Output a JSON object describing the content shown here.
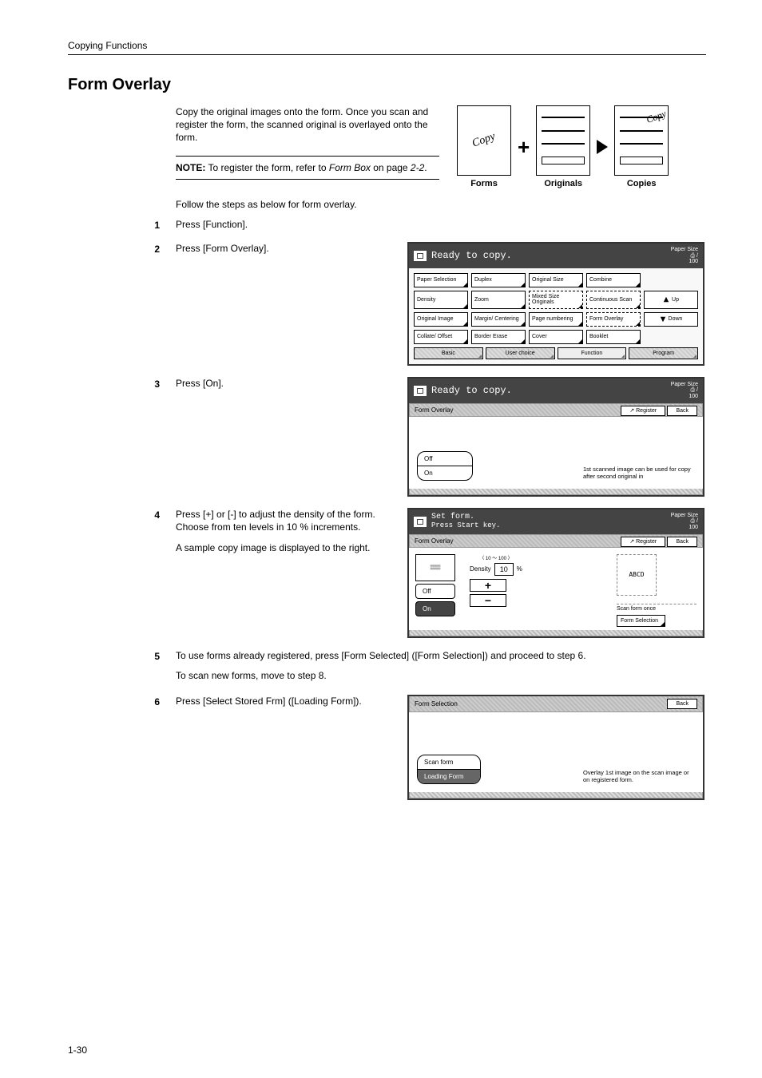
{
  "breadcrumb": "Copying Functions",
  "section_title": "Form Overlay",
  "intro": "Copy the original images onto the form. Once you scan and register the form, the scanned original is overlayed onto the form.",
  "note_label": "NOTE:",
  "note_text": " To register the form, refer to ",
  "note_ref": "Form Box",
  "note_tail": " on page ",
  "note_page": "2-2",
  "note_period": ".",
  "follow_text": "Follow the steps as below for form overlay.",
  "diagram_labels": {
    "forms": "Forms",
    "originals": "Originals",
    "copies": "Copies"
  },
  "copy_word": "Copy",
  "steps": {
    "s1": "Press [Function].",
    "s2": "Press [Form Overlay].",
    "s3": "Press [On].",
    "s4a": "Press [+] or [-] to adjust the density of the form. Choose from ten levels in 10 % increments.",
    "s4b": "A sample copy image is displayed to the right.",
    "s5a": "To use forms already registered, press [Form Selected] ([Form Selection]) and proceed to step 6.",
    "s5b": "To scan new forms, move to step 8.",
    "s6": "Press [Select Stored Frm] ([Loading Form])."
  },
  "panel_common": {
    "ready": "Ready to copy.",
    "paper_size": "Paper Size",
    "ratio": "100",
    "register": "Register",
    "back": "Back"
  },
  "panel1": {
    "buttons": [
      [
        "Paper Selection",
        "Duplex",
        "Original Size",
        "Combine",
        ""
      ],
      [
        "Density",
        "Zoom",
        "Mixed Size Originals",
        "Continuous Scan",
        "Up"
      ],
      [
        "Original Image",
        "Margin/ Centering",
        "Page numbering",
        "Form Overlay",
        "Down"
      ],
      [
        "Collate/ Offset",
        "Border Erase",
        "Cover",
        "Booklet",
        ""
      ]
    ],
    "tabs": [
      "Basic",
      "User choice",
      "Function",
      "Program"
    ]
  },
  "panel2": {
    "crumb": "Form Overlay",
    "off": "Off",
    "on": "On",
    "note": "1st scanned image can be used for copy after second original in"
  },
  "panel3": {
    "title": "Set form.",
    "sub": "Press Start key.",
    "crumb": "Form Overlay",
    "density_lbl": "Density",
    "range": "〈 10 ～ 100 〉",
    "value": "10",
    "pct": "%",
    "off": "Off",
    "on": "On",
    "abcd": "ABCD",
    "scan_once": "Scan form once",
    "form_sel": "Form Selection"
  },
  "panel4": {
    "crumb": "Form Selection",
    "back": "Back",
    "scan_form": "Scan form",
    "loading_form": "Loading Form",
    "note": "Overlay 1st image on the scan image or on registered form."
  },
  "page_number": "1-30"
}
